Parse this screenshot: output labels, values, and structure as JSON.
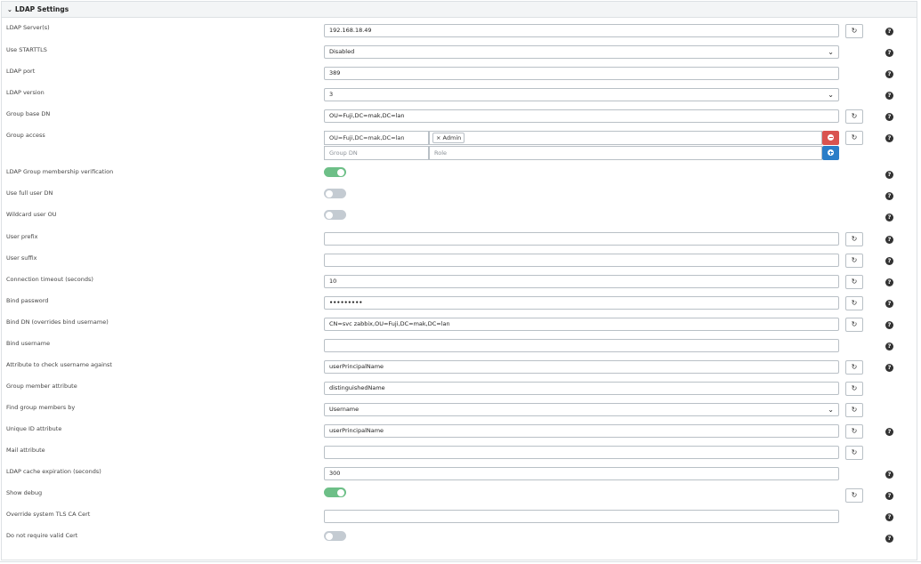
{
  "panel": {
    "title": "LDAP Settings"
  },
  "icons": {
    "reset": "↻",
    "help": "?",
    "caret": "⌄",
    "chevron": "⌵"
  },
  "colors": {
    "toggle_on": "#6dbf87",
    "toggle_off": "#c4cbd2",
    "remove_button": "#d9534f",
    "add_button": "#2a7dc8"
  },
  "fields": {
    "ldap_servers": {
      "label": "LDAP Server(s)",
      "value": "192.168.18.49"
    },
    "use_starttls": {
      "label": "Use STARTTLS",
      "value": "Disabled"
    },
    "ldap_port": {
      "label": "LDAP port",
      "value": "389"
    },
    "ldap_version": {
      "label": "LDAP version",
      "value": "3"
    },
    "group_base_dn": {
      "label": "Group base DN",
      "value": "OU=Fuji,DC=mak,DC=lan"
    },
    "group_access": {
      "label": "Group access",
      "row_dn": "OU=Fuji,DC=mak,DC=lan",
      "row_role_chip": "Admin",
      "chip_remove": "×",
      "new_dn_placeholder": "Group DN",
      "new_role_placeholder": "Role"
    },
    "group_membership_verification": {
      "label": "LDAP Group membership verification",
      "enabled": true
    },
    "use_full_user_dn": {
      "label": "Use full user DN",
      "enabled": false
    },
    "wildcard_user_ou": {
      "label": "Wildcard user OU",
      "enabled": false
    },
    "user_prefix": {
      "label": "User prefix",
      "value": ""
    },
    "user_suffix": {
      "label": "User suffix",
      "value": ""
    },
    "connection_timeout": {
      "label": "Connection timeout (seconds)",
      "value": "10"
    },
    "bind_password": {
      "label": "Bind password",
      "value": "•••••••••"
    },
    "bind_dn": {
      "label": "Bind DN (overrides bind username)",
      "value": "CN=svc zabbix,OU=Fuji,DC=mak,DC=lan"
    },
    "bind_username": {
      "label": "Bind username",
      "value": ""
    },
    "username_attribute": {
      "label": "Attribute to check username against",
      "value": "userPrincipalName"
    },
    "group_member_attribute": {
      "label": "Group member attribute",
      "value": "distinguishedName"
    },
    "find_group_members_by": {
      "label": "Find group members by",
      "value": "Username"
    },
    "unique_id_attribute": {
      "label": "Unique ID attribute",
      "value": "userPrincipalName"
    },
    "mail_attribute": {
      "label": "Mail attribute",
      "value": ""
    },
    "cache_expiration": {
      "label": "LDAP cache expiration (seconds)",
      "value": "300"
    },
    "show_debug": {
      "label": "Show debug",
      "enabled": true
    },
    "override_tls_ca_cert": {
      "label": "Override system TLS CA Cert",
      "value": ""
    },
    "no_valid_cert": {
      "label": "Do not require valid Cert",
      "enabled": false
    }
  }
}
